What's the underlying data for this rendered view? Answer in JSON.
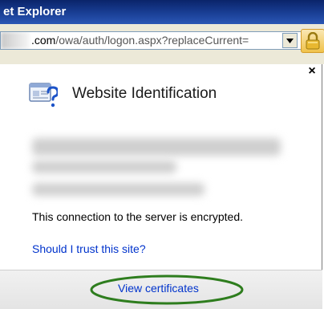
{
  "window": {
    "title": "et Explorer"
  },
  "address_bar": {
    "domain_part": ".com",
    "path_part": "/owa/auth/logon.aspx?replaceCurrent=",
    "dropdown_icon": "chevron-down-icon",
    "lock_icon": "lock-icon"
  },
  "popup": {
    "close_glyph": "×",
    "icon": "website-identification-icon",
    "title": "Website Identification",
    "encrypted_text": "This connection to the server is encrypted.",
    "trust_link": "Should I trust this site?",
    "view_certificates": "View certificates"
  },
  "colors": {
    "link": "#0033cc",
    "titlebar": "#0a246a",
    "highlight": "#2e7d1e"
  }
}
